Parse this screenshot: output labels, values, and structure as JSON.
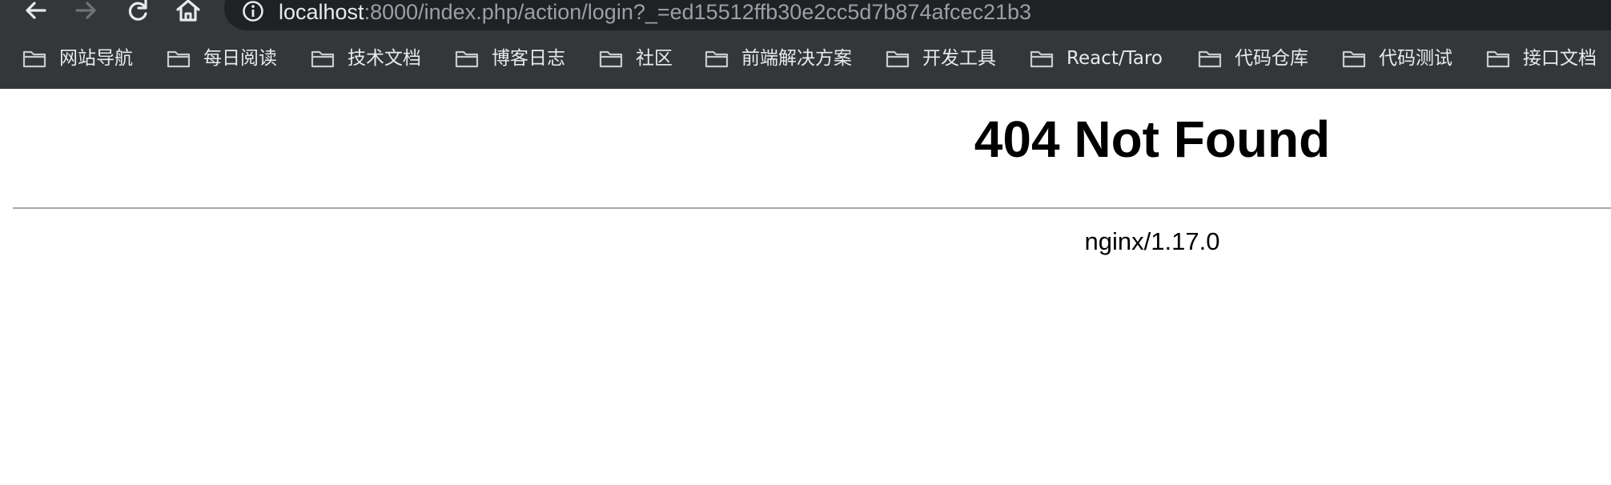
{
  "browser": {
    "url": {
      "host": "localhost",
      "rest": ":8000/index.php/action/login?_=ed15512ffb30e2cc5d7b874afcec21b3"
    },
    "icons": {
      "back": "arrow-left-icon",
      "forward": "arrow-right-icon",
      "reload": "reload-icon",
      "home": "home-icon",
      "info": "info-icon",
      "bookmark_folder": "folder-icon"
    },
    "colors": {
      "chrome_background": "#35363a",
      "omnibox_background": "#202124",
      "primary_text": "#e8eaed",
      "secondary_text": "#9aa0a6",
      "forward_disabled": "#6f7276"
    },
    "bookmarks": [
      {
        "label": "网站导航"
      },
      {
        "label": "每日阅读"
      },
      {
        "label": "技术文档"
      },
      {
        "label": "博客日志"
      },
      {
        "label": "社区"
      },
      {
        "label": "前端解决方案"
      },
      {
        "label": "开发工具"
      },
      {
        "label": "React/Taro"
      },
      {
        "label": "代码仓库"
      },
      {
        "label": "代码测试"
      },
      {
        "label": "接口文档"
      }
    ]
  },
  "page": {
    "title": "404 Not Found",
    "server": "nginx/1.17.0"
  }
}
